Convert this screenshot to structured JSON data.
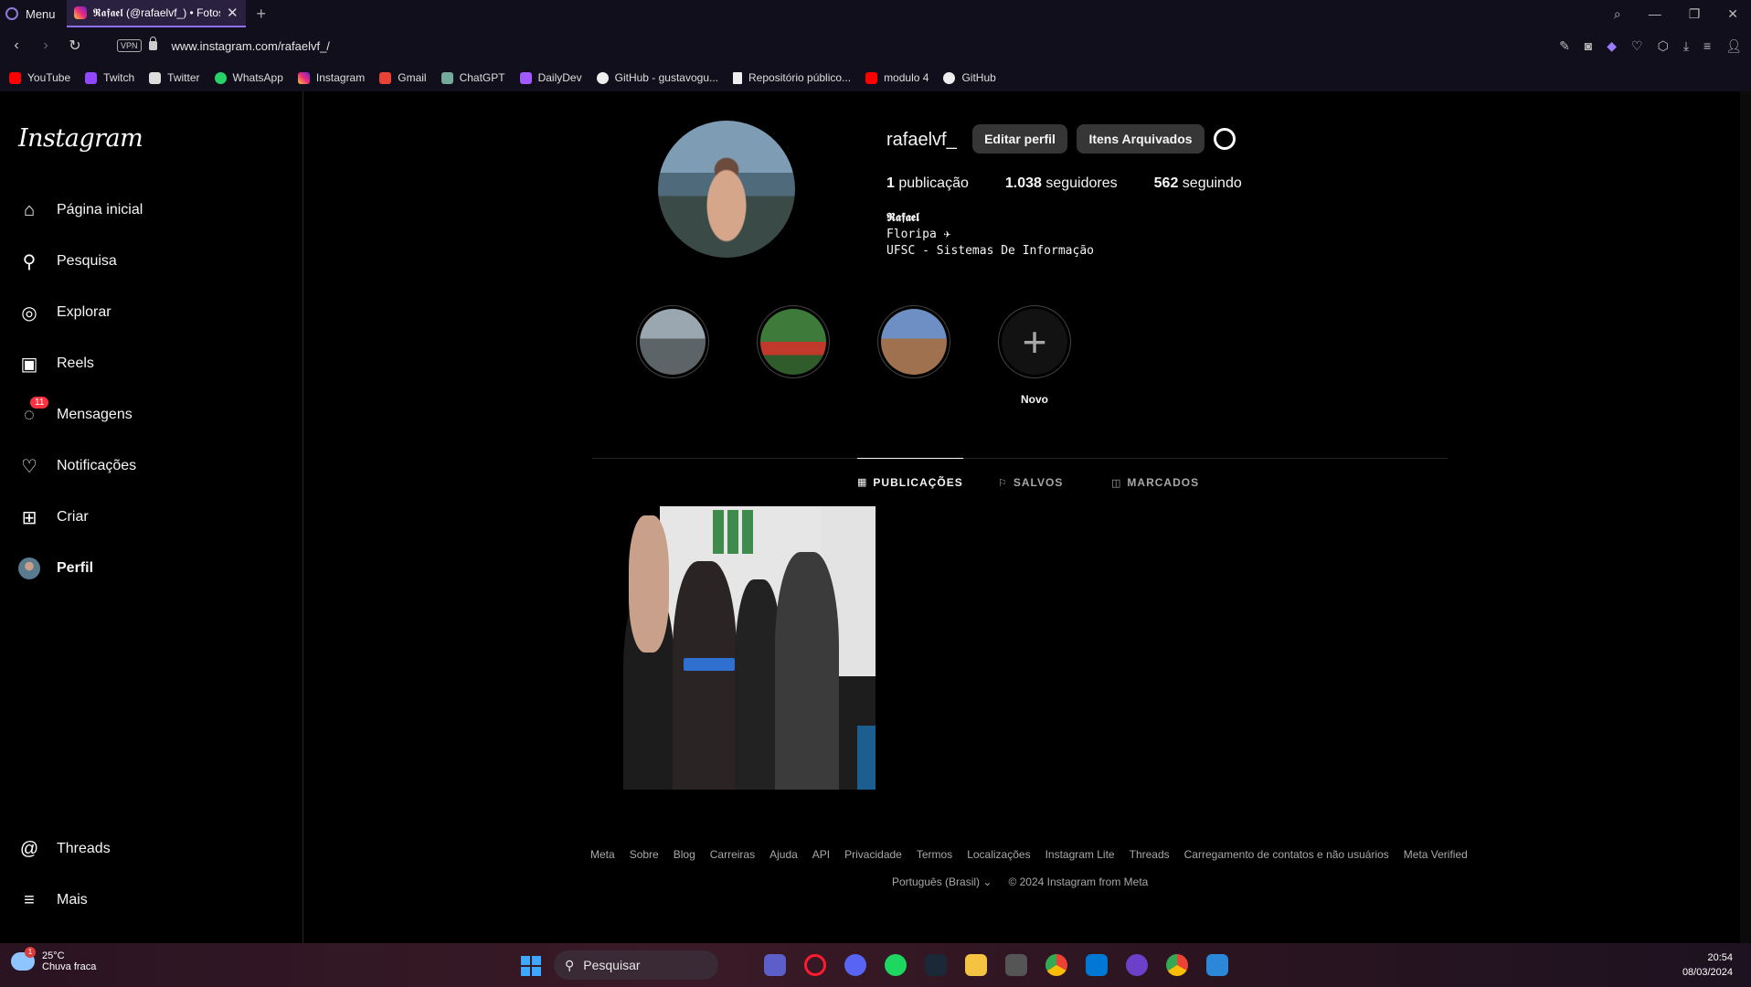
{
  "browser": {
    "menu_label": "Menu",
    "tab_title": "𝕽𝖆𝖋𝖆𝖊𝖑 (@rafaelvf_) • Fotos",
    "url": "www.instagram.com/rafaelvf_/",
    "vpn_label": "VPN",
    "bookmarks": [
      {
        "label": "YouTube",
        "color": "#ff0000"
      },
      {
        "label": "Twitch",
        "color": "#9146ff"
      },
      {
        "label": "Twitter",
        "color": "#ffffff"
      },
      {
        "label": "WhatsApp",
        "color": "#25d366"
      },
      {
        "label": "Instagram",
        "color": "#e1306c"
      },
      {
        "label": "Gmail",
        "color": "#ea4335"
      },
      {
        "label": "ChatGPT",
        "color": "#74aa9c"
      },
      {
        "label": "DailyDev",
        "color": "#a259ff"
      },
      {
        "label": "GitHub - gustavogu...",
        "color": "#ffffff"
      },
      {
        "label": "Repositório público...",
        "color": "#ffffff"
      },
      {
        "label": "modulo 4",
        "color": "#ff0000"
      },
      {
        "label": "GitHub",
        "color": "#ffffff"
      }
    ]
  },
  "sidebar": {
    "logo": "Instagram",
    "items": [
      {
        "label": "Página inicial",
        "icon": "home-icon"
      },
      {
        "label": "Pesquisa",
        "icon": "search-icon"
      },
      {
        "label": "Explorar",
        "icon": "compass-icon"
      },
      {
        "label": "Reels",
        "icon": "reels-icon"
      },
      {
        "label": "Mensagens",
        "icon": "messenger-icon",
        "badge": "11"
      },
      {
        "label": "Notificações",
        "icon": "heart-icon"
      },
      {
        "label": "Criar",
        "icon": "plus-square-icon"
      },
      {
        "label": "Perfil",
        "icon": "avatar"
      }
    ],
    "bottom_items": [
      {
        "label": "Threads",
        "icon": "threads-icon"
      },
      {
        "label": "Mais",
        "icon": "menu-icon"
      }
    ]
  },
  "profile": {
    "username": "rafaelvf_",
    "edit_button": "Editar perfil",
    "archive_button": "Itens Arquivados",
    "posts_count": "1",
    "posts_label": "publicação",
    "followers_count": "1.038",
    "followers_label": "seguidores",
    "following_count": "562",
    "following_label": "seguindo",
    "bio_name": "𝕽𝖆𝖋𝖆𝖊𝖑",
    "bio_line1": "Floripa ✈",
    "bio_line2": "UFSC - Sistemas De Informação"
  },
  "highlights": {
    "new_label": "Novo"
  },
  "tabs": [
    {
      "label": "PUBLICAÇÕES",
      "icon": "grid-icon",
      "active": true
    },
    {
      "label": "SALVOS",
      "icon": "bookmark-icon",
      "active": false
    },
    {
      "label": "MARCADOS",
      "icon": "tagged-icon",
      "active": false
    }
  ],
  "footer": {
    "links": [
      "Meta",
      "Sobre",
      "Blog",
      "Carreiras",
      "Ajuda",
      "API",
      "Privacidade",
      "Termos",
      "Localizações",
      "Instagram Lite",
      "Threads",
      "Carregamento de contatos e não usuários",
      "Meta Verified"
    ],
    "language": "Português (Brasil)",
    "copyright": "© 2024 Instagram from Meta"
  },
  "taskbar": {
    "temperature": "25°C",
    "weather": "Chuva fraca",
    "weather_badge": "1",
    "search_placeholder": "Pesquisar",
    "time": "20:54",
    "date": "08/03/2024"
  }
}
